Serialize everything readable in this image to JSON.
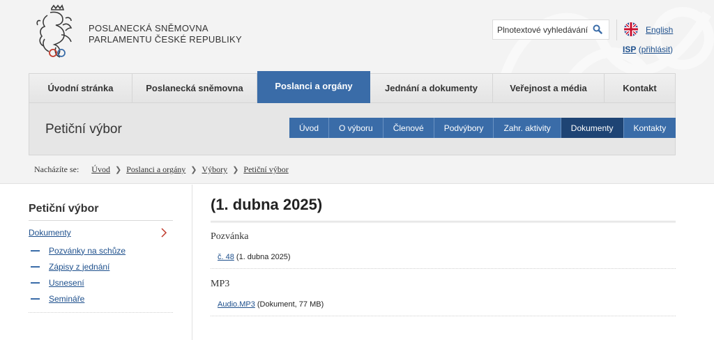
{
  "header": {
    "org_line1": "POSLANECKÁ SNĚMOVNA",
    "org_line2": "PARLAMENTU ČESKÉ REPUBLIKY",
    "search_placeholder": "Plnotextové vyhledávání",
    "language_link": "English",
    "isp_label": "ISP",
    "isp_open": "(",
    "isp_login": "přihlásit",
    "isp_close": ")"
  },
  "main_nav": {
    "items": [
      {
        "label": "Úvodní stránka"
      },
      {
        "label": "Poslanecká sněmovna"
      },
      {
        "label": "Poslanci a orgány"
      },
      {
        "label": "Jednání a dokumenty"
      },
      {
        "label": "Veřejnost a média"
      },
      {
        "label": "Kontakt"
      }
    ],
    "active_index": 2
  },
  "section": {
    "title": "Petiční výbor",
    "subnav": [
      {
        "label": "Úvod"
      },
      {
        "label": "O výboru"
      },
      {
        "label": "Členové"
      },
      {
        "label": "Podvýbory"
      },
      {
        "label": "Zahr. aktivity"
      },
      {
        "label": "Dokumenty"
      },
      {
        "label": "Kontakty"
      }
    ],
    "active_subnav_index": 5
  },
  "breadcrumb": {
    "label": "Nacházíte se:",
    "items": [
      "Úvod",
      "Poslanci a orgány",
      "Výbory",
      "Petiční výbor"
    ]
  },
  "sidebar": {
    "title": "Petiční výbor",
    "active_item": "Dokumenty",
    "items": [
      "Pozvánky na schůze",
      "Zápisy z jednání",
      "Usnesení",
      "Semináře"
    ]
  },
  "content": {
    "heading": "(1. dubna 2025)",
    "sections": [
      {
        "title": "Pozvánka",
        "link": "č. 48",
        "text": " (1. dubna 2025)"
      },
      {
        "title": "MP3",
        "link": "Audio.MP3",
        "text": " (Dokument, 77 MB)"
      }
    ]
  },
  "colors": {
    "accent": "#3a6ca8",
    "accent_dark": "#1e4474",
    "link": "#1d4f8c"
  }
}
